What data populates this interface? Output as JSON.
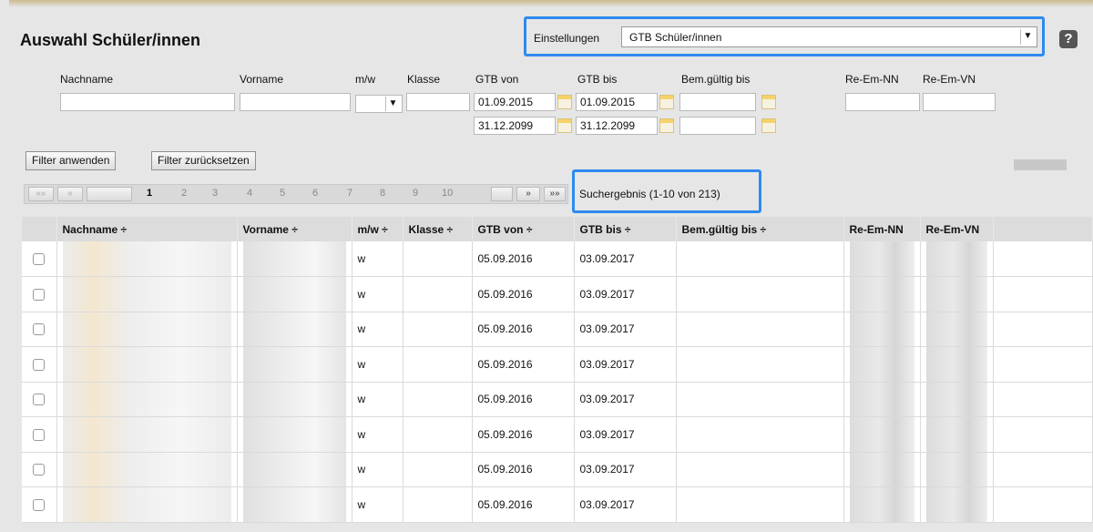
{
  "header": {
    "title": "Auswahl Schüler/innen"
  },
  "settings": {
    "label": "Einstellungen",
    "value": "GTB Schüler/innen"
  },
  "help": {
    "label": "?"
  },
  "filters": {
    "nachname_label": "Nachname",
    "vorname_label": "Vorname",
    "mw_label": "m/w",
    "klasse_label": "Klasse",
    "gtb_von_label": "GTB von",
    "gtb_bis_label": "GTB bis",
    "bem_label": "Bem.gültig bis",
    "re_em_nn_label": "Re-Em-NN",
    "re_em_vn_label": "Re-Em-VN",
    "gtb_von_from": "01.09.2015",
    "gtb_bis_from": "01.09.2015",
    "gtb_von_to": "31.12.2099",
    "gtb_bis_to": "31.12.2099"
  },
  "buttons": {
    "apply": "Filter anwenden",
    "reset": "Filter zurücksetzen"
  },
  "pager": {
    "first": "««",
    "prev": "«",
    "next": "»",
    "last": "»»",
    "pages": [
      "1",
      "2",
      "3",
      "4",
      "5",
      "6",
      "7",
      "8",
      "9",
      "10"
    ],
    "current": "1",
    "result": "Suchergebnis (1-10 von 213)"
  },
  "table": {
    "columns": [
      "Nachname ÷",
      "Vorname ÷",
      "m/w ÷",
      "Klasse ÷",
      "GTB von ÷",
      "GTB bis ÷",
      "Bem.gültig bis ÷",
      "Re-Em-NN",
      "Re-Em-VN"
    ],
    "rows": [
      {
        "mw": "w",
        "klasse": "",
        "von": "05.09.2016",
        "bis": "03.09.2017",
        "bem": ""
      },
      {
        "mw": "w",
        "klasse": "",
        "von": "05.09.2016",
        "bis": "03.09.2017",
        "bem": ""
      },
      {
        "mw": "w",
        "klasse": "",
        "von": "05.09.2016",
        "bis": "03.09.2017",
        "bem": ""
      },
      {
        "mw": "w",
        "klasse": "",
        "von": "05.09.2016",
        "bis": "03.09.2017",
        "bem": ""
      },
      {
        "mw": "w",
        "klasse": "",
        "von": "05.09.2016",
        "bis": "03.09.2017",
        "bem": ""
      },
      {
        "mw": "w",
        "klasse": "",
        "von": "05.09.2016",
        "bis": "03.09.2017",
        "bem": ""
      },
      {
        "mw": "w",
        "klasse": "",
        "von": "05.09.2016",
        "bis": "03.09.2017",
        "bem": ""
      },
      {
        "mw": "w",
        "klasse": "",
        "von": "05.09.2016",
        "bis": "03.09.2017",
        "bem": ""
      }
    ]
  },
  "colors": {
    "highlight": "#2e8af0",
    "header_bg": "#dcdcdc",
    "page_bg": "#e6e6e6"
  }
}
